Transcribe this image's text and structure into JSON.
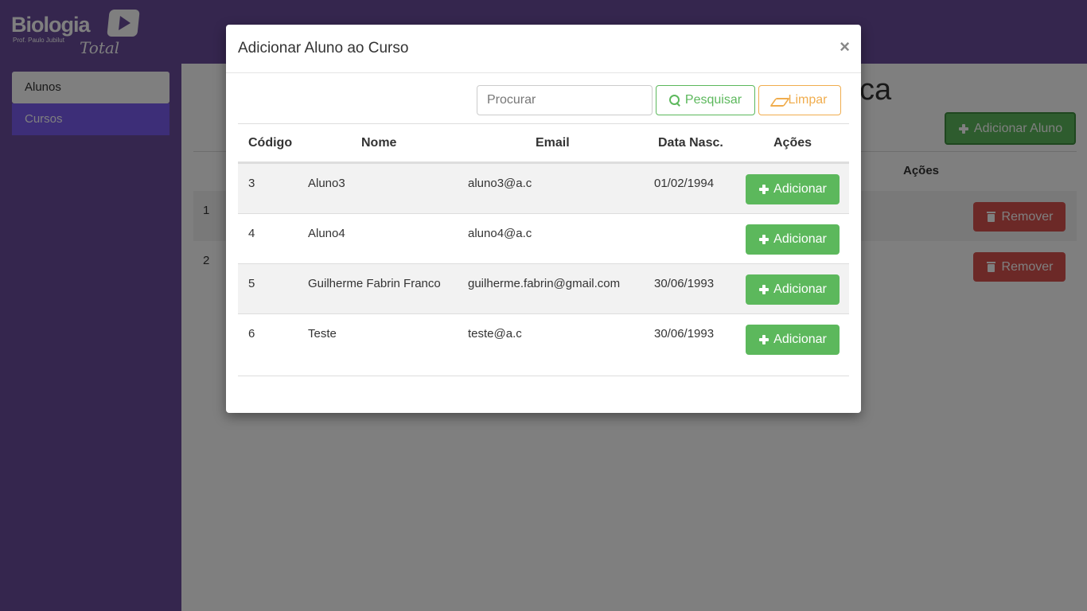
{
  "app": {
    "logo_text": "Biologia",
    "logo_sub": "Prof. Paulo Jubilut",
    "logo_script": "Total"
  },
  "sidebar": {
    "items": [
      {
        "label": "Alunos",
        "active": true
      },
      {
        "label": "Cursos",
        "active": false
      }
    ]
  },
  "page": {
    "title_fragment": "ca",
    "add_button_label": "Adicionar Aluno",
    "table_actions_header": "Ações",
    "rows": [
      {
        "num": "1",
        "remove_label": "Remover"
      },
      {
        "num": "2",
        "remove_label": "Remover"
      }
    ]
  },
  "modal": {
    "title": "Adicionar Aluno ao Curso",
    "close_symbol": "×",
    "search_placeholder": "Procurar",
    "search_button": "Pesquisar",
    "clear_button": "Limpar",
    "headers": {
      "codigo": "Código",
      "nome": "Nome",
      "email": "Email",
      "data_nasc": "Data Nasc.",
      "acoes": "Ações"
    },
    "rows": [
      {
        "codigo": "3",
        "nome": "Aluno3",
        "email": "aluno3@a.c",
        "data_nasc": "01/02/1994",
        "action": "Adicionar"
      },
      {
        "codigo": "4",
        "nome": "Aluno4",
        "email": "aluno4@a.c",
        "data_nasc": "",
        "action": "Adicionar"
      },
      {
        "codigo": "5",
        "nome": "Guilherme Fabrin Franco",
        "email": "guilherme.fabrin@gmail.com",
        "data_nasc": "30/06/1993",
        "action": "Adicionar"
      },
      {
        "codigo": "6",
        "nome": "Teste",
        "email": "teste@a.c",
        "data_nasc": "30/06/1993",
        "action": "Adicionar"
      }
    ]
  },
  "colors": {
    "brand_purple": "#6a4c9c",
    "sidebar_active_bg": "#7a5cf0",
    "success": "#5cb85c",
    "warning": "#f0ad4e",
    "danger": "#d9534f"
  }
}
